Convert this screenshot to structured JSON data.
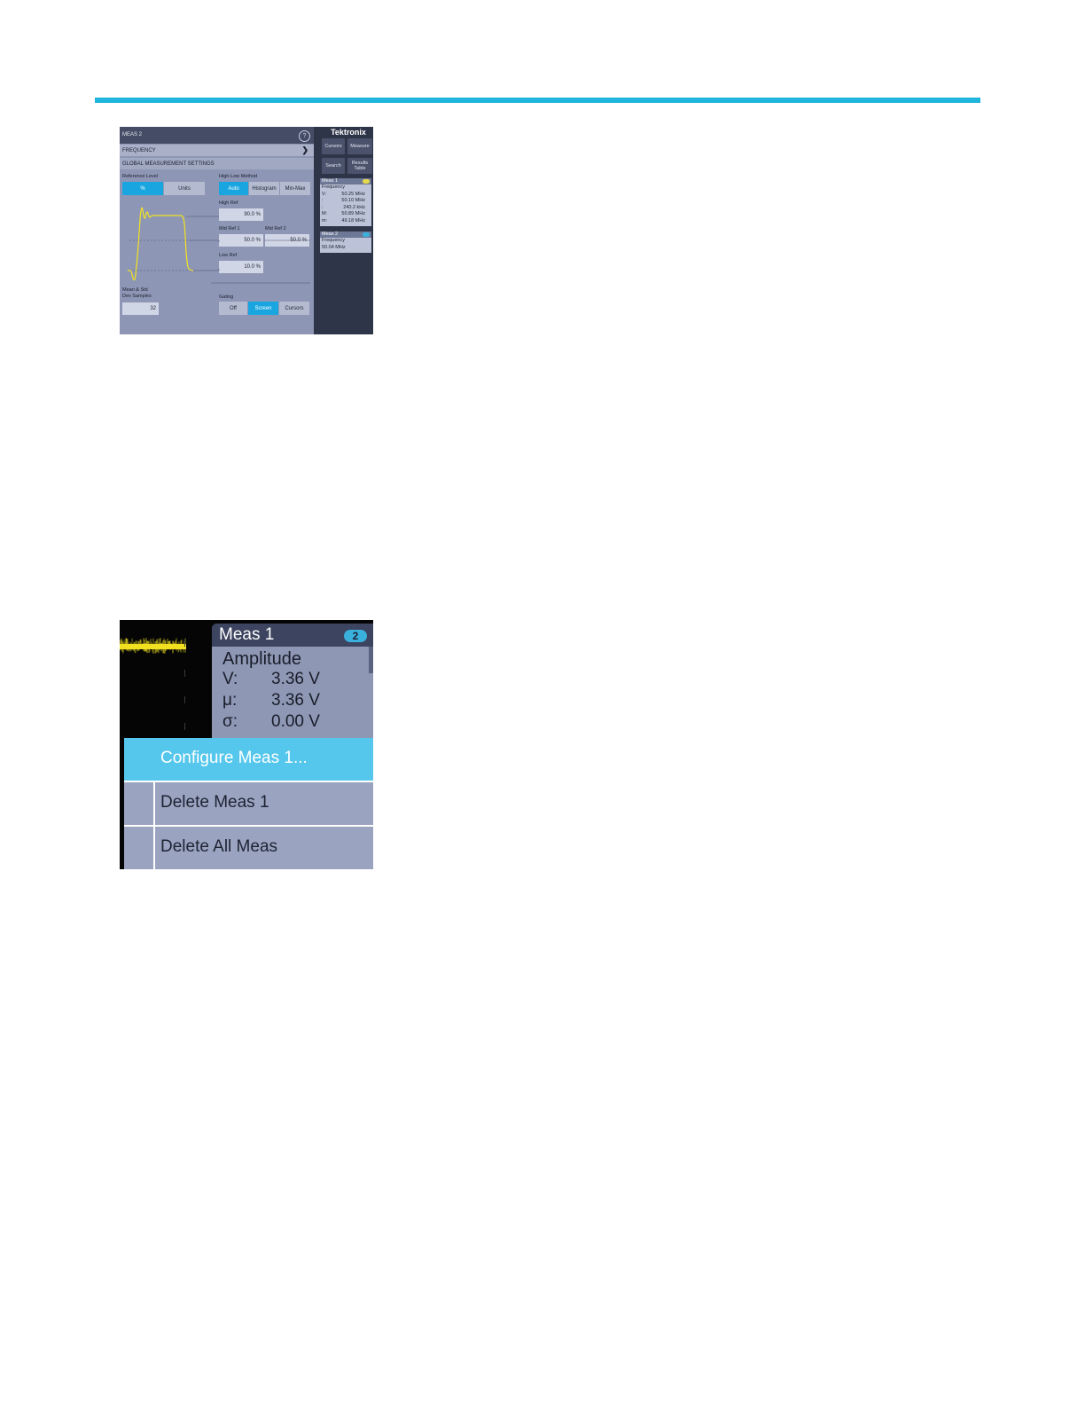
{
  "screen1": {
    "panel": {
      "title": "MEAS 2",
      "help_glyph": "?",
      "measurement_type": "FREQUENCY",
      "chevron": "❯",
      "section_title": "GLOBAL MEASUREMENT SETTINGS",
      "reference_level": {
        "label": "Reference Level",
        "options": [
          "%",
          "Units"
        ],
        "selected": "%"
      },
      "high_low_method": {
        "label": "High-Low Method",
        "options": [
          "Auto",
          "Histogram",
          "Min-Max"
        ],
        "selected": "Auto"
      },
      "high_ref": {
        "label": "High Ref",
        "value": "90.0 %"
      },
      "mid_ref_1": {
        "label": "Mid Ref 1",
        "value": "50.0 %"
      },
      "mid_ref_2": {
        "label": "Mid Ref 2",
        "value": "50.0 %"
      },
      "low_ref": {
        "label": "Low Ref",
        "value": "10.0 %"
      },
      "mean_std": {
        "label_line1": "Mean & Std",
        "label_line2": "Dev Samples",
        "value": "32"
      },
      "gating": {
        "label": "Gating",
        "options": [
          "Off",
          "Screen",
          "Cursors"
        ],
        "selected": "Screen"
      },
      "waveform_color": "#f2e320"
    },
    "sidebar": {
      "brand": "Tektronix",
      "buttons": {
        "cursors": "Cursors",
        "measure": "Measure",
        "search": "Search",
        "results_line1": "Results",
        "results_line2": "Table"
      },
      "meas1": {
        "title": "Meas 1",
        "badge_color": "#e6d84a",
        "type": "Frequency",
        "rows": [
          {
            "k": "V:",
            "v": "50.25 MHz"
          },
          {
            "k": ":",
            "v": "50.10 MHz"
          },
          {
            "k": ":",
            "v": "240.2 kHz"
          },
          {
            "k": "M:",
            "v": "50.89 MHz"
          },
          {
            "k": "m:",
            "v": "49.18 MHz"
          }
        ]
      },
      "meas2": {
        "title": "Meas 2",
        "badge_color": "#3ab0dc",
        "type": "Frequency",
        "value": "50.04 MHz"
      }
    }
  },
  "screen2": {
    "card": {
      "title": "Meas 1",
      "badge": "2",
      "type": "Amplitude",
      "rows": [
        {
          "k": "V:",
          "v": "3.36 V"
        },
        {
          "k": "μ:",
          "v": "3.36 V"
        },
        {
          "k": "σ:",
          "v": "0.00 V"
        }
      ]
    },
    "context_menu": {
      "items": [
        "Configure Meas 1...",
        "Delete Meas 1",
        "Delete All Meas"
      ],
      "selected": "Configure Meas 1..."
    },
    "trace_color": "#f0e020"
  },
  "accent_color": "#1fb5dd"
}
